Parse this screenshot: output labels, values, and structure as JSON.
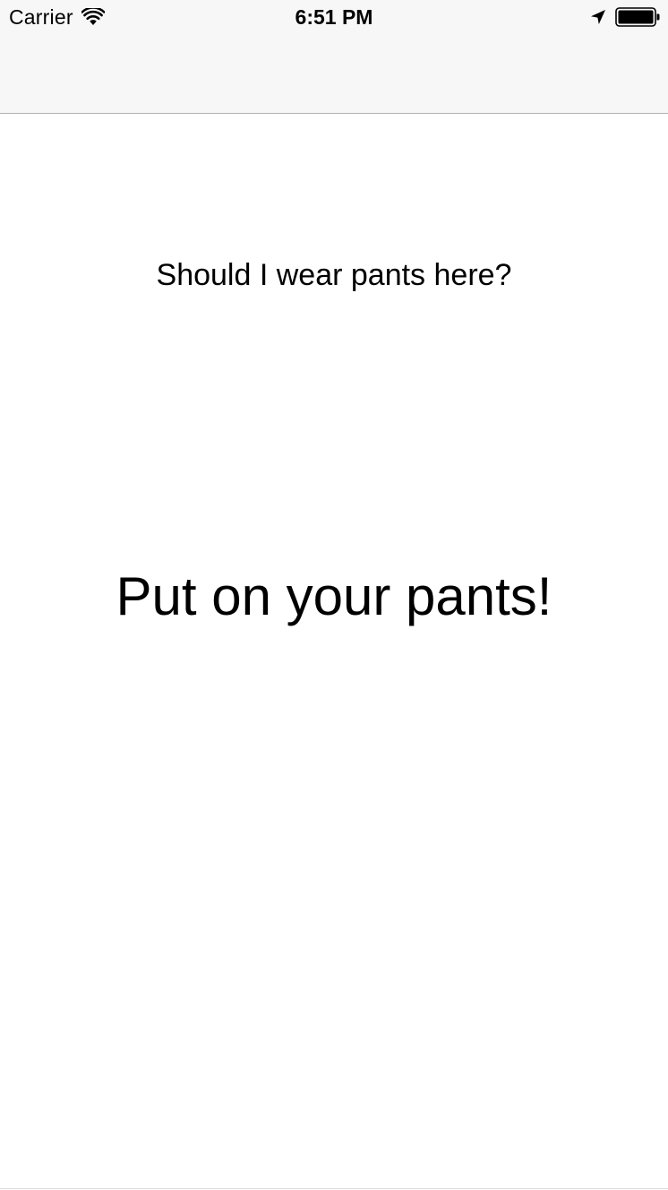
{
  "status_bar": {
    "carrier": "Carrier",
    "time": "6:51 PM",
    "icons": {
      "wifi": "wifi-icon",
      "location": "location-arrow-icon",
      "battery": "battery-full-icon"
    }
  },
  "main": {
    "question": "Should I wear pants here?",
    "answer": "Put on your pants!"
  },
  "colors": {
    "background": "#ffffff",
    "nav_bar_background": "#f7f7f7",
    "nav_bar_border": "#b2b2b2",
    "text": "#000000"
  }
}
